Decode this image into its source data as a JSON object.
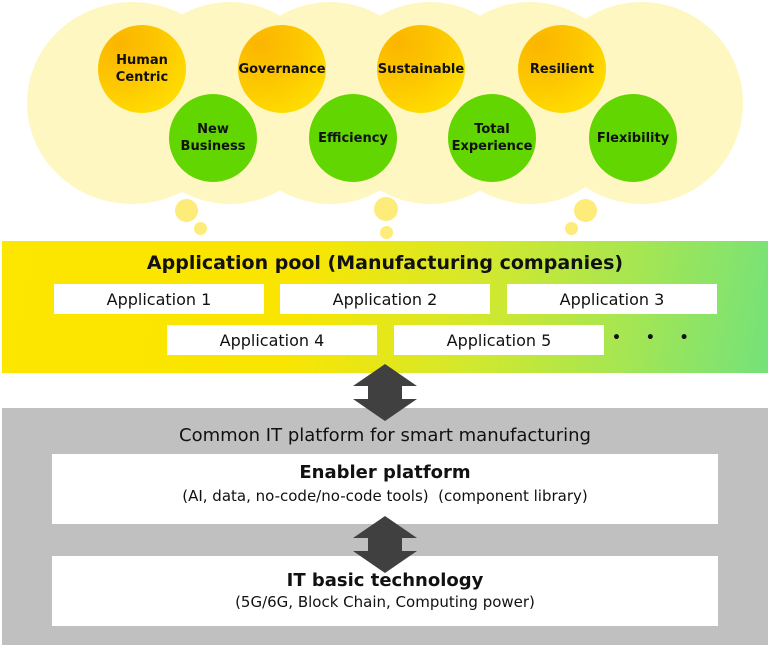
{
  "values_cloud": {
    "orange_values": [
      "Human\nCentric",
      "Governance",
      "Sustainable",
      "Resilient"
    ],
    "green_values": [
      "New\nBusiness",
      "Efficiency",
      "Total\nExperience",
      "Flexibility"
    ]
  },
  "application_pool": {
    "title": "Application pool (Manufacturing companies)",
    "applications": [
      "Application 1",
      "Application 2",
      "Application 3",
      "Application 4",
      "Application 5"
    ],
    "more": "• • •"
  },
  "platform": {
    "title": "Common IT platform for smart manufacturing",
    "enabler": {
      "title": "Enabler platform",
      "subtitle": "(AI, data, no-code/no-code tools)  (component library)"
    },
    "basic": {
      "title": "IT basic technology",
      "subtitle": "(5G/6G, Block Chain, Computing power)"
    }
  },
  "colors": {
    "cloud": "#fff7c2",
    "orange": "#fdc800",
    "green": "#62d600",
    "band_yellow": "#fde600",
    "band_green": "#74e27a",
    "gray": "#c0c0c0",
    "arrow": "#404040"
  }
}
